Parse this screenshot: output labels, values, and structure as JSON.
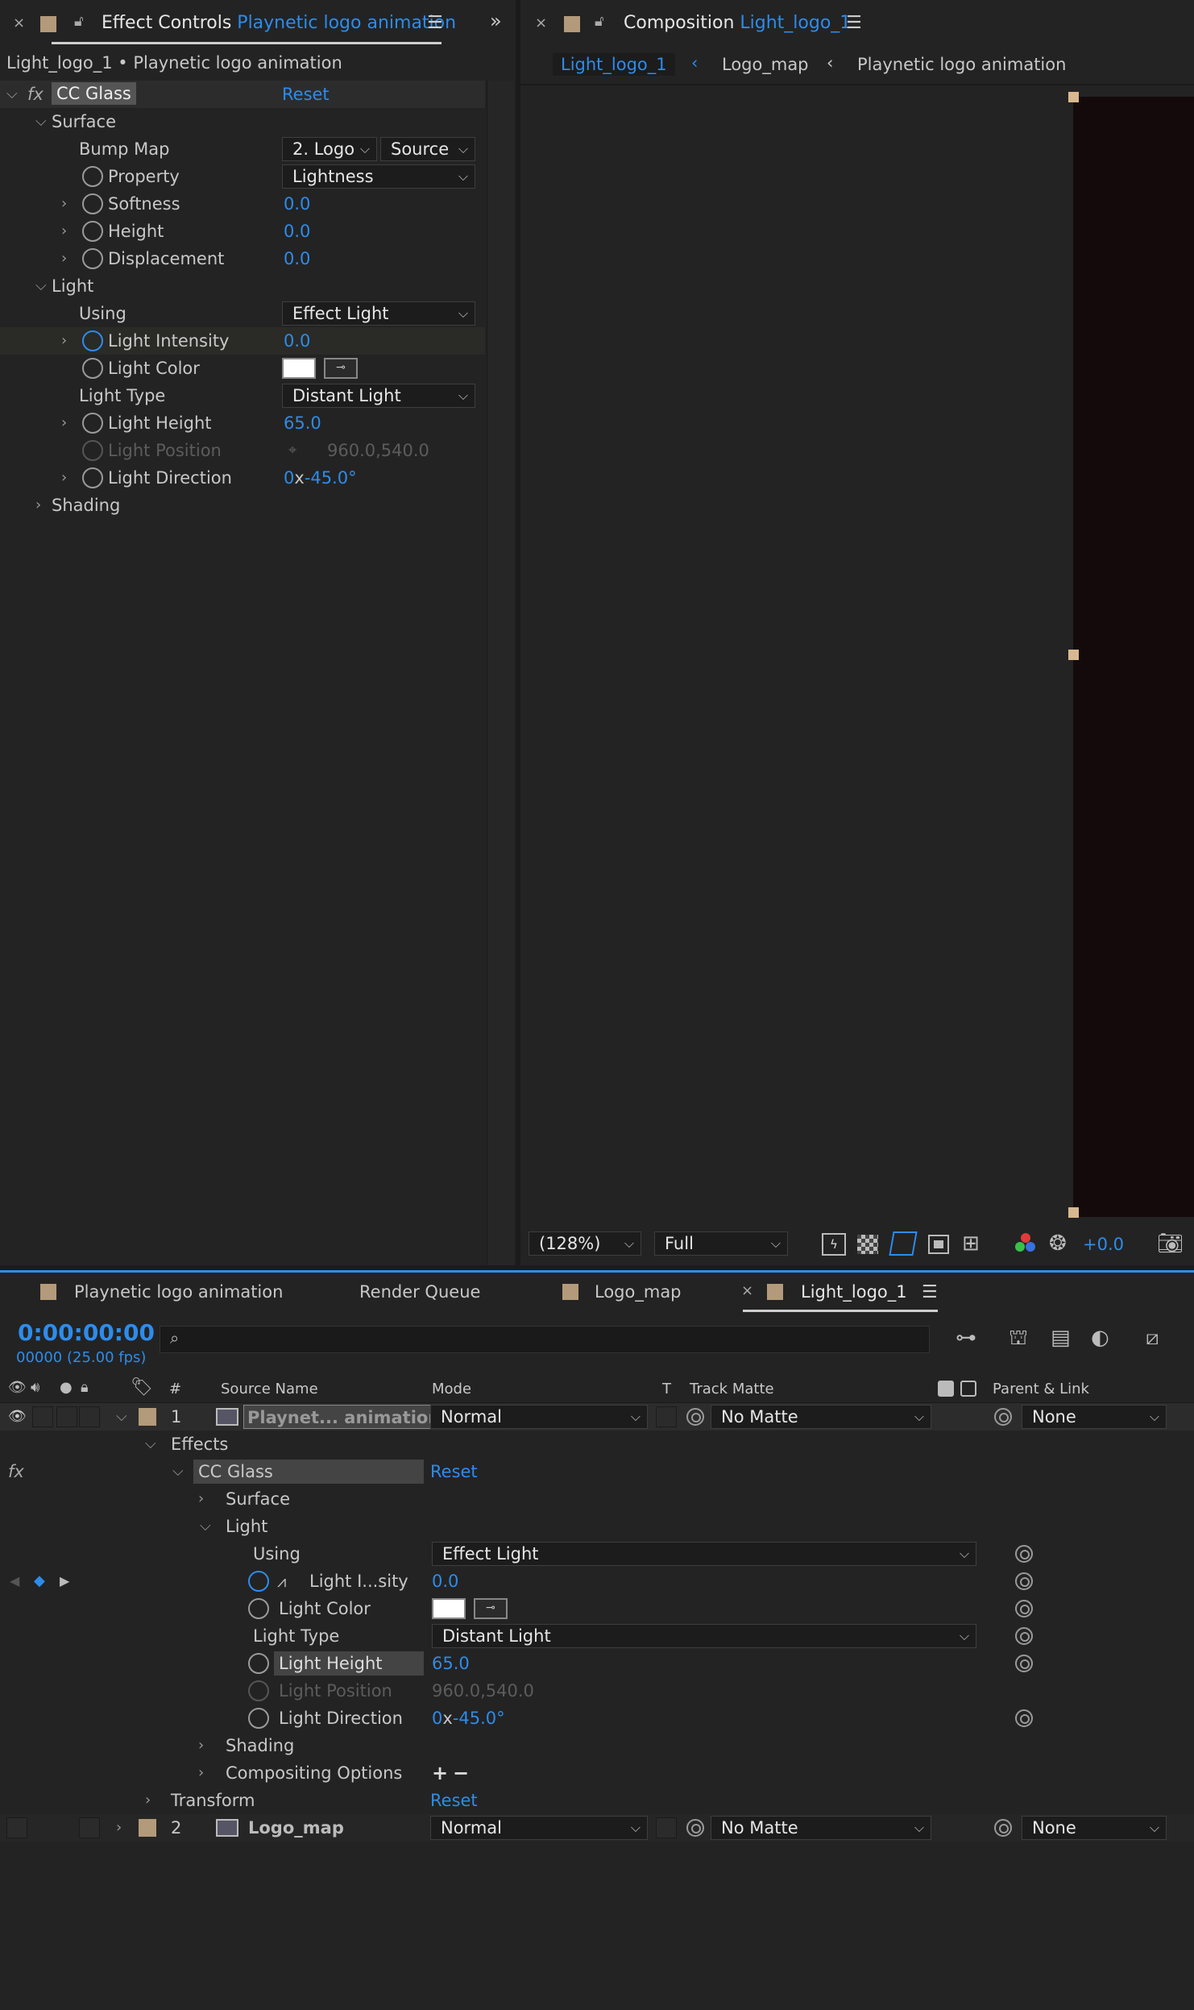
{
  "effect_controls": {
    "tab_prefix": "Effect Controls",
    "tab_layer": "Playnetic logo animation",
    "breadcrumb": "Light_logo_1 • Playnetic logo animation",
    "effect_name": "CC Glass",
    "reset": "Reset",
    "surface": "Surface",
    "bump_map_label": "Bump Map",
    "bump_map_value": "2. Logo",
    "bump_map_source": "Source",
    "property_label": "Property",
    "property_value": "Lightness",
    "softness_label": "Softness",
    "softness_value": "0.0",
    "height_label": "Height",
    "height_value": "0.0",
    "displacement_label": "Displacement",
    "displacement_value": "0.0",
    "light": "Light",
    "using_label": "Using",
    "using_value": "Effect Light",
    "light_intensity_label": "Light Intensity",
    "light_intensity_value": "0.0",
    "light_color_label": "Light Color",
    "light_type_label": "Light Type",
    "light_type_value": "Distant Light",
    "light_height_label": "Light Height",
    "light_height_value": "65.0",
    "light_position_label": "Light Position",
    "light_position_value": "960.0,540.0",
    "light_direction_label": "Light Direction",
    "light_direction_rev": "0",
    "light_direction_x": "x",
    "light_direction_deg": "-45.0°",
    "shading": "Shading"
  },
  "composition": {
    "tab_prefix": "Composition",
    "tab_name": "Light_logo_1",
    "crumbs": [
      "Light_logo_1",
      "Logo_map",
      "Playnetic logo animation"
    ],
    "zoom": "(128%)",
    "resolution": "Full",
    "exposure": "+0.0"
  },
  "timeline": {
    "tabs": [
      "Playnetic logo animation",
      "Render Queue",
      "Logo_map",
      "Light_logo_1"
    ],
    "timecode": "0:00:00:00",
    "frames": "00000 (25.00 fps)",
    "columns": {
      "num": "#",
      "source": "Source Name",
      "mode": "Mode",
      "t": "T",
      "matte": "Track Matte",
      "parent": "Parent & Link"
    },
    "layer1": {
      "num": "1",
      "name": "Playnet... animation",
      "mode": "Normal",
      "matte": "No Matte",
      "parent": "None"
    },
    "effects": "Effects",
    "cc_glass": "CC Glass",
    "reset": "Reset",
    "surface": "Surface",
    "light": "Light",
    "using_label": "Using",
    "using_value": "Effect Light",
    "intensity_label": "Light I...sity",
    "intensity_value": "0.0",
    "color_label": "Light Color",
    "type_label": "Light Type",
    "type_value": "Distant Light",
    "height_label": "Light Height",
    "height_value": "65.0",
    "position_label": "Light Position",
    "position_value": "960.0,540.0",
    "direction_label": "Light Direction",
    "direction_rev": "0",
    "direction_x": "x",
    "direction_deg": "-45.0°",
    "shading": "Shading",
    "compositing": "Compositing Options",
    "transform": "Transform",
    "transform_reset": "Reset",
    "layer2": {
      "num": "2",
      "name": "Logo_map",
      "mode": "Normal",
      "matte": "No Matte",
      "parent": "None"
    }
  }
}
